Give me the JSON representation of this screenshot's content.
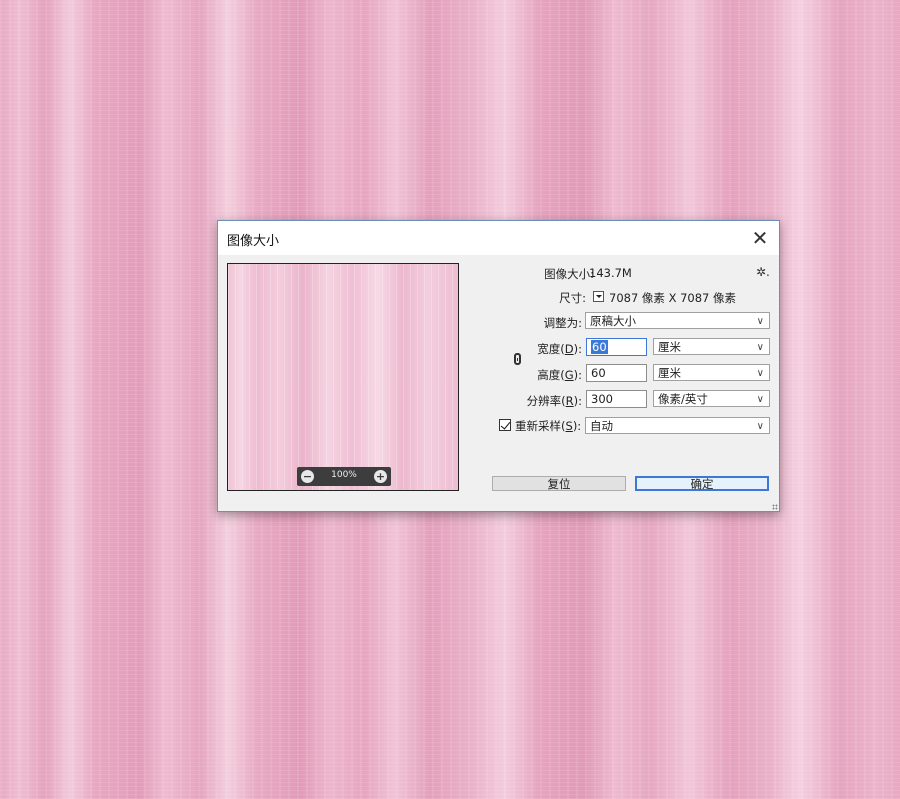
{
  "dialog": {
    "title": "图像大小",
    "close_glyph": "✕"
  },
  "preview": {
    "zoom_value": "100%",
    "zoom_out_glyph": "−",
    "zoom_in_glyph": "+"
  },
  "info": {
    "image_size_label": "图像大小:",
    "image_size_value": "143.7M",
    "dimensions_label": "尺寸:",
    "dimensions_value": "7087 像素  X  7087 像素",
    "gear_glyph": "✲."
  },
  "form": {
    "fit_to_label": "调整为:",
    "fit_to_value": "原稿大小",
    "width_label_prefix": "宽度(",
    "width_label_key": "D",
    "width_label_suffix": "):",
    "width_value": "60",
    "width_unit": "厘米",
    "height_label_prefix": "高度(",
    "height_label_key": "G",
    "height_label_suffix": "):",
    "height_value": "60",
    "height_unit": "厘米",
    "resolution_label_prefix": "分辨率(",
    "resolution_label_key": "R",
    "resolution_label_suffix": "):",
    "resolution_value": "300",
    "resolution_unit": "像素/英寸",
    "resample_label_prefix": "重新采样(",
    "resample_label_key": "S",
    "resample_label_suffix": "):",
    "resample_checked": true,
    "resample_value": "自动",
    "dropdown_arrow": "∨"
  },
  "buttons": {
    "reset_label": "复位",
    "ok_label": "确定"
  },
  "colors": {
    "accent": "#3c78d8",
    "background_pink": "#e7a3c0"
  }
}
